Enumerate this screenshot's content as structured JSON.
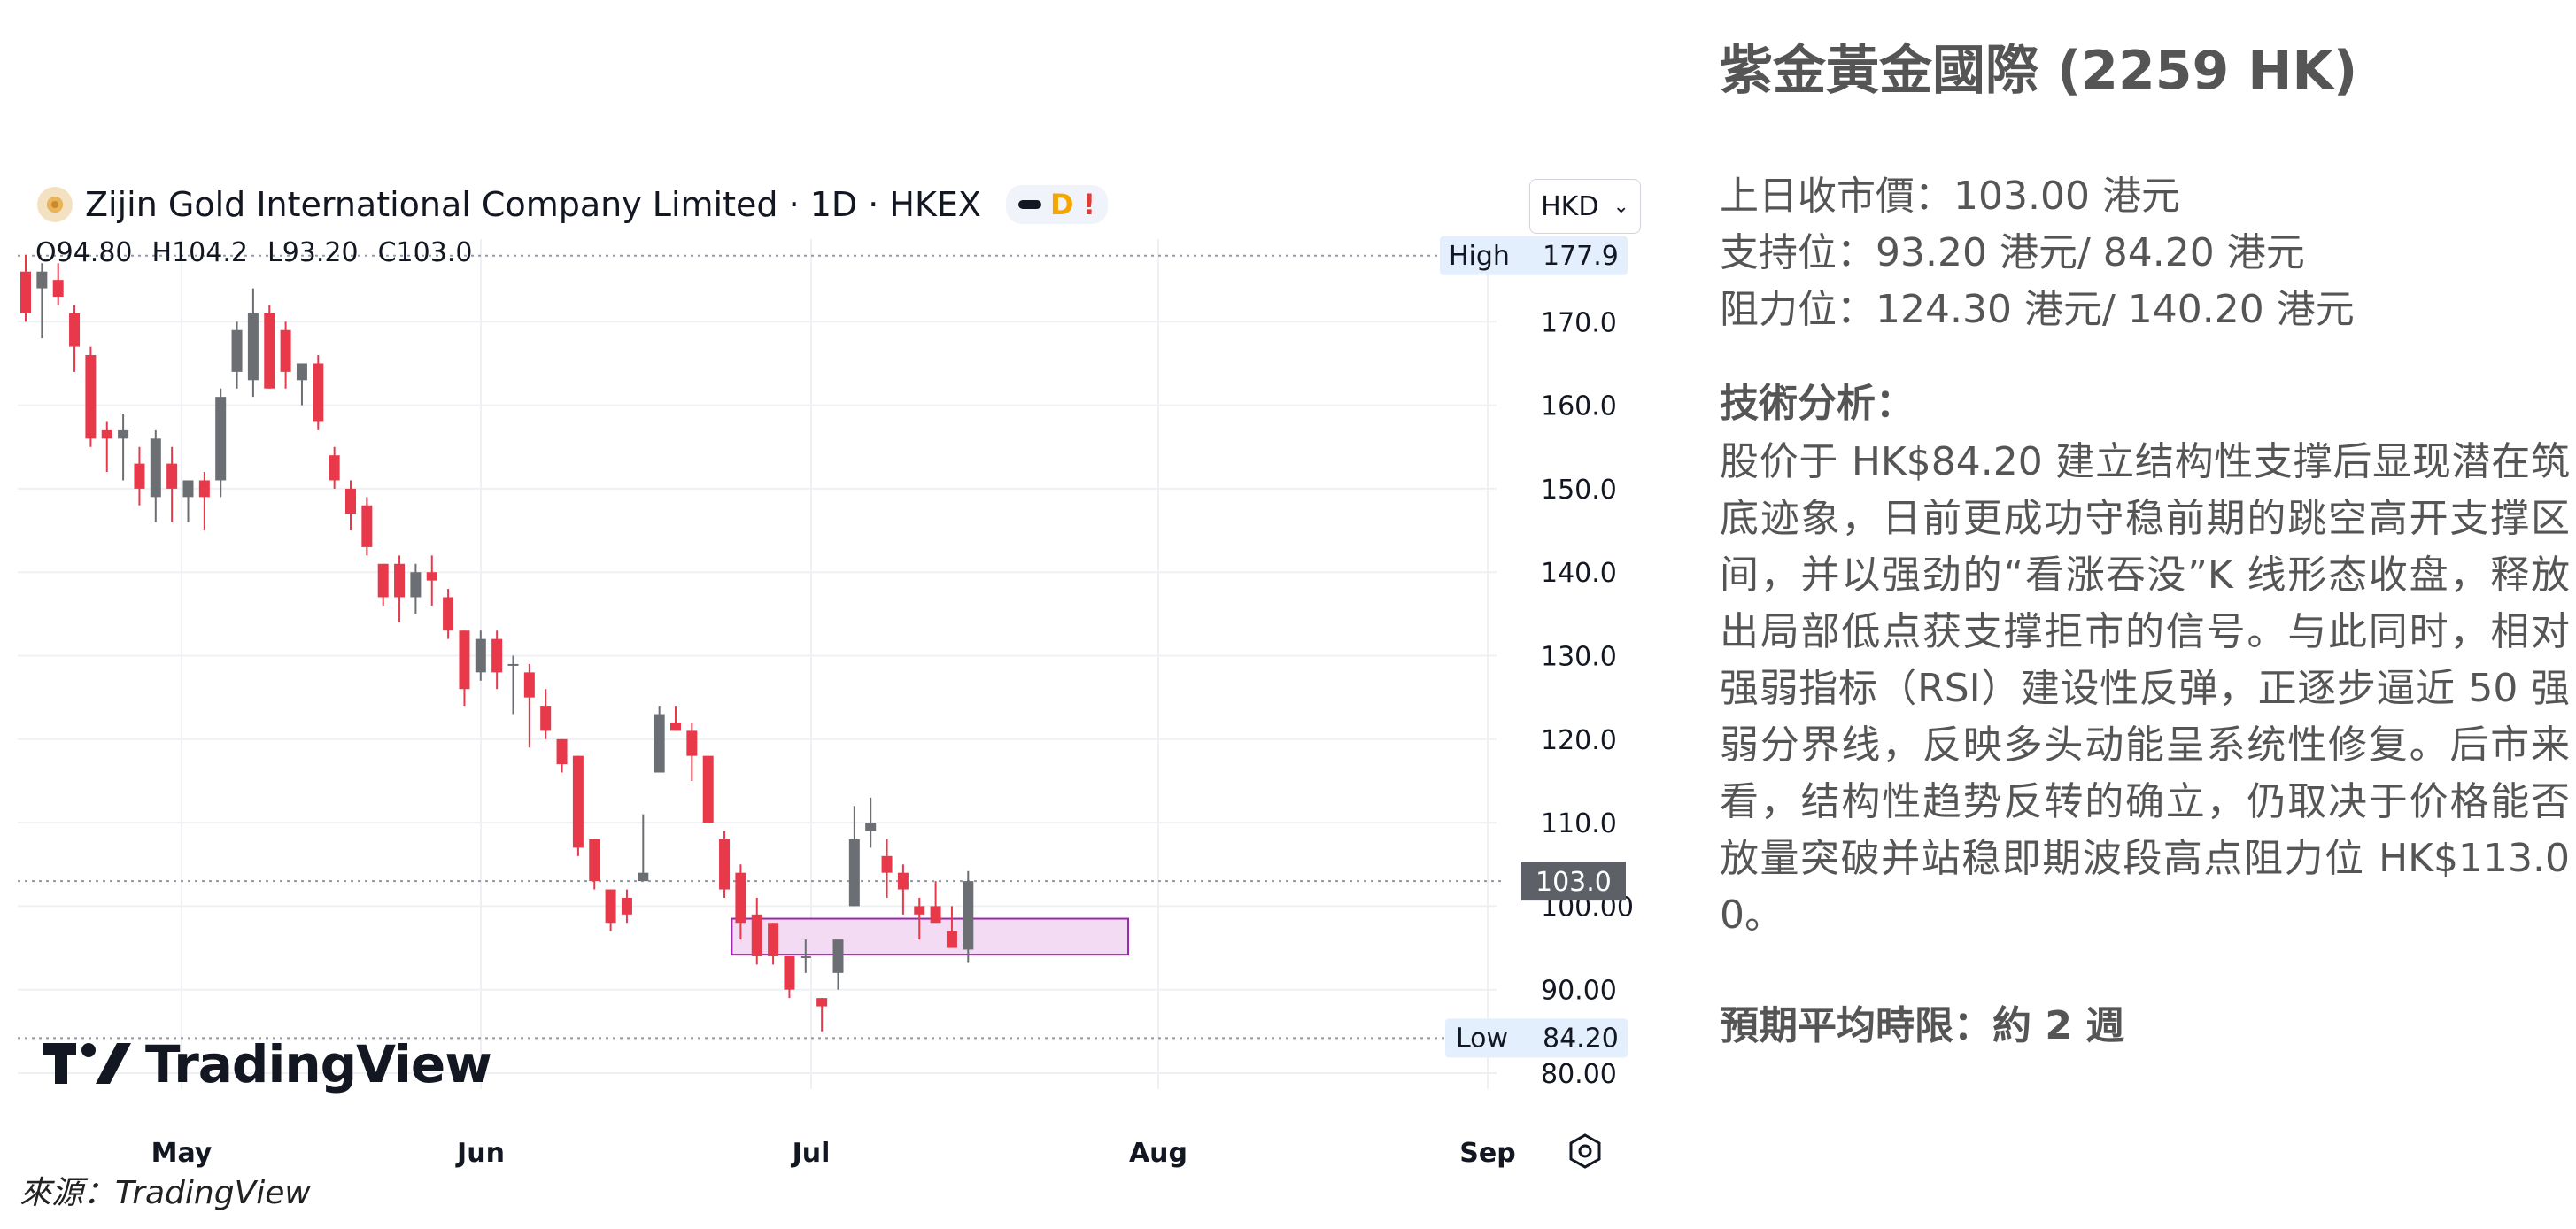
{
  "chart": {
    "symbol_title": "Zijin Gold International Company Limited · 1D · HKEX",
    "flags": {
      "d": "D",
      "warn": "!"
    },
    "ohlc": {
      "o_label": "O",
      "o": "94.80",
      "h_label": "H",
      "h": "104.2",
      "l_label": "L",
      "l": "93.20",
      "c_label": "C",
      "c": "103.0"
    },
    "currency": "HKD",
    "high_label": "High",
    "high_value": "177.9",
    "low_label": "Low",
    "low_value": "84.20",
    "last_price": "103.0",
    "logo_text": "TradingView",
    "source_text": "來源：TradingView",
    "colors": {
      "up": "#6b6e73",
      "down": "#e8394b",
      "box_fill": "#f3dcf3",
      "box_stroke": "#9c27b0",
      "grid": "#eef0f4"
    }
  },
  "chart_data": {
    "type": "candlestick",
    "title": "Zijin Gold International Company Limited · 1D · HKEX",
    "y_ticks": [
      "80.00",
      "90.00",
      "100.00",
      "110.0",
      "120.0",
      "130.0",
      "140.0",
      "150.0",
      "160.0",
      "170.0"
    ],
    "y_tick_values": [
      80,
      90,
      100,
      110,
      120,
      130,
      140,
      150,
      160,
      170
    ],
    "x_ticks": [
      "May",
      "Jun",
      "Jul",
      "Aug",
      "Sep"
    ],
    "ylim": [
      76,
      180
    ],
    "grid": true,
    "high": 177.9,
    "low": 84.2,
    "last": 103.0,
    "support_zone": {
      "from_candle": 44,
      "to_date": "2025-07-27",
      "y_top": 98.5,
      "y_bottom": 94.2
    },
    "candles": [
      {
        "o": 176,
        "h": 178,
        "l": 170,
        "c": 171
      },
      {
        "o": 174,
        "h": 177,
        "l": 168,
        "c": 176
      },
      {
        "o": 175,
        "h": 177,
        "l": 172,
        "c": 173
      },
      {
        "o": 171,
        "h": 172,
        "l": 164,
        "c": 167
      },
      {
        "o": 166,
        "h": 167,
        "l": 155,
        "c": 156
      },
      {
        "o": 157,
        "h": 158,
        "l": 152,
        "c": 156
      },
      {
        "o": 156,
        "h": 159,
        "l": 151,
        "c": 157
      },
      {
        "o": 153,
        "h": 155,
        "l": 148,
        "c": 150
      },
      {
        "o": 149,
        "h": 157,
        "l": 146,
        "c": 156
      },
      {
        "o": 153,
        "h": 155,
        "l": 146,
        "c": 150
      },
      {
        "o": 149,
        "h": 151,
        "l": 146,
        "c": 151
      },
      {
        "o": 151,
        "h": 152,
        "l": 145,
        "c": 149
      },
      {
        "o": 151,
        "h": 162,
        "l": 149,
        "c": 161
      },
      {
        "o": 164,
        "h": 170,
        "l": 162,
        "c": 169
      },
      {
        "o": 163,
        "h": 174,
        "l": 161,
        "c": 171
      },
      {
        "o": 171,
        "h": 172,
        "l": 162,
        "c": 162
      },
      {
        "o": 169,
        "h": 170,
        "l": 162,
        "c": 164
      },
      {
        "o": 163,
        "h": 165,
        "l": 160,
        "c": 165
      },
      {
        "o": 165,
        "h": 166,
        "l": 157,
        "c": 158
      },
      {
        "o": 154,
        "h": 155,
        "l": 150,
        "c": 151
      },
      {
        "o": 150,
        "h": 151,
        "l": 145,
        "c": 147
      },
      {
        "o": 148,
        "h": 149,
        "l": 142,
        "c": 143
      },
      {
        "o": 141,
        "h": 141,
        "l": 136,
        "c": 137
      },
      {
        "o": 141,
        "h": 142,
        "l": 134,
        "c": 137
      },
      {
        "o": 137,
        "h": 141,
        "l": 135,
        "c": 140
      },
      {
        "o": 140,
        "h": 142,
        "l": 136,
        "c": 139
      },
      {
        "o": 137,
        "h": 138,
        "l": 132,
        "c": 133
      },
      {
        "o": 133,
        "h": 133,
        "l": 124,
        "c": 126
      },
      {
        "o": 128,
        "h": 133,
        "l": 127,
        "c": 132
      },
      {
        "o": 132,
        "h": 133,
        "l": 126,
        "c": 128
      },
      {
        "o": 129,
        "h": 130,
        "l": 123,
        "c": 129
      },
      {
        "o": 128,
        "h": 129,
        "l": 119,
        "c": 125
      },
      {
        "o": 124,
        "h": 126,
        "l": 120,
        "c": 121
      },
      {
        "o": 120,
        "h": 120,
        "l": 116,
        "c": 117
      },
      {
        "o": 118,
        "h": 118,
        "l": 106,
        "c": 107
      },
      {
        "o": 108,
        "h": 108,
        "l": 102,
        "c": 103
      },
      {
        "o": 102,
        "h": 102,
        "l": 97,
        "c": 98
      },
      {
        "o": 101,
        "h": 102,
        "l": 98,
        "c": 99
      },
      {
        "o": 103,
        "h": 111,
        "l": 103,
        "c": 104
      },
      {
        "o": 116,
        "h": 124,
        "l": 116,
        "c": 123
      },
      {
        "o": 122,
        "h": 124,
        "l": 121,
        "c": 121
      },
      {
        "o": 121,
        "h": 122,
        "l": 115,
        "c": 118
      },
      {
        "o": 118,
        "h": 118,
        "l": 110,
        "c": 110
      },
      {
        "o": 108,
        "h": 109,
        "l": 101,
        "c": 102
      },
      {
        "o": 104,
        "h": 105,
        "l": 96,
        "c": 98
      },
      {
        "o": 99,
        "h": 101,
        "l": 93,
        "c": 94
      },
      {
        "o": 98,
        "h": 98,
        "l": 93,
        "c": 94
      },
      {
        "o": 94,
        "h": 94,
        "l": 89,
        "c": 90
      },
      {
        "o": 94,
        "h": 96,
        "l": 92,
        "c": 94
      },
      {
        "o": 89,
        "h": 89,
        "l": 85,
        "c": 88
      },
      {
        "o": 92,
        "h": 95,
        "l": 90,
        "c": 96
      },
      {
        "o": 100,
        "h": 112,
        "l": 100,
        "c": 108
      },
      {
        "o": 109,
        "h": 113,
        "l": 107,
        "c": 110
      },
      {
        "o": 106,
        "h": 108,
        "l": 101,
        "c": 104
      },
      {
        "o": 104,
        "h": 105,
        "l": 99,
        "c": 102
      },
      {
        "o": 100,
        "h": 101,
        "l": 96,
        "c": 99
      },
      {
        "o": 100,
        "h": 103,
        "l": 98,
        "c": 98
      },
      {
        "o": 97,
        "h": 100,
        "l": 95,
        "c": 95
      },
      {
        "o": 94.8,
        "h": 104.2,
        "l": 93.2,
        "c": 103
      }
    ]
  },
  "panel": {
    "title": "紫金黃金國際 (2259 HK)",
    "prev_close": "上日收市價：103.00 港元",
    "support": "支持位：93.20 港元/ 84.20 港元",
    "resistance": "阻力位：124.30 港元/ 140.20 港元",
    "analysis_heading": "技術分析：",
    "analysis_text": "股价于 HK$84.20 建立结构性支撑后显现潜在筑底迹象，日前更成功守稳前期的跳空高开支撑区间，并以强劲的“看涨吞没”K 线形态收盘，释放出局部低点获支撑拒市的信号。与此同时，相对强弱指标（RSI）建设性反弹，正逐步逼近 50 强弱分界线，反映多头动能呈系统性修复。后市来看，结构性趋势反转的确立，仍取决于价格能否放量突破并站稳即期波段高点阻力位 HK$113.00。",
    "period": "預期平均時限：約 2 週"
  }
}
